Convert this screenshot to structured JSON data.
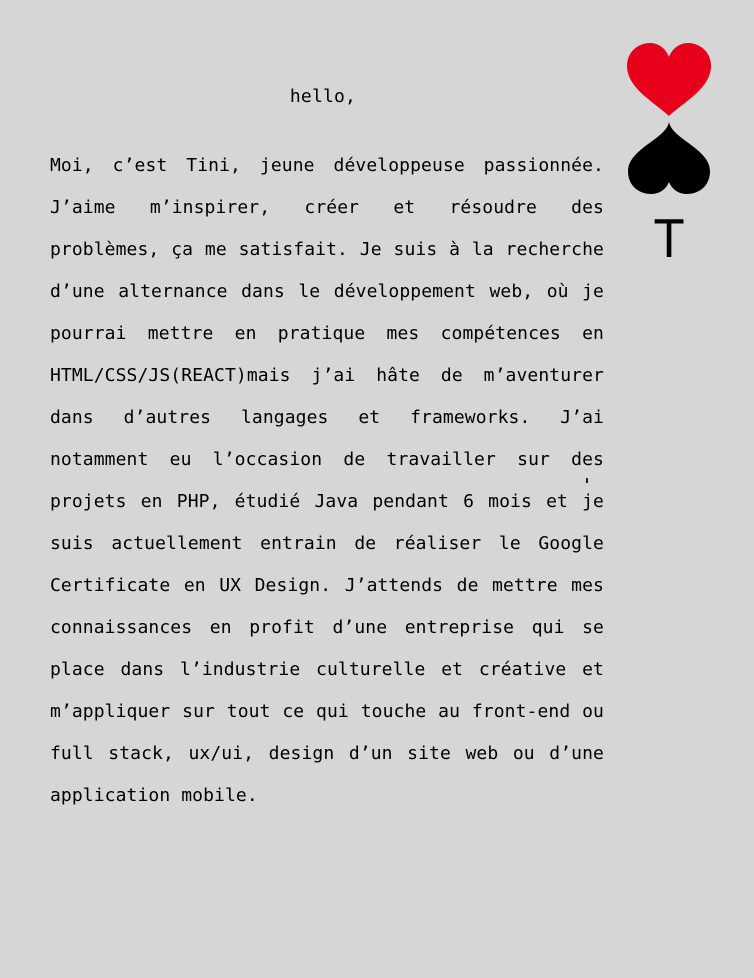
{
  "greeting": "hello,",
  "bio": "Moi, c’est Tini, jeune développeuse passionnée. J’aime m’inspirer, créer et résoudre des problèmes, ça me satisfait. Je suis à la recherche d’une alternance dans le développement web, où je pourrai mettre en pratique mes compétences en HTML/CSS/JS(REACT)mais j’ai hâte de m’aventurer dans d’autres langages et frameworks. J’ai notamment eu l’occasion de travailler sur des projets en PHP, étudié Java pendant 6 mois et je suis actuellement entrain de réaliser le Google Certificate en UX Design. J’attends de mettre mes connaissances en profit d’une entreprise qui se place dans l’industrie culturelle et créative et m’appliquer sur tout ce qui touche au front-end ou full stack, ux/ui, design d’un site web ou d’une application mobile.",
  "logo": {
    "letter": "T",
    "heart_icon": "heart-icon",
    "spade_icon": "spade-icon",
    "heart_color": "#e8001a",
    "spade_color": "#000000"
  },
  "colors": {
    "background": "#d6d6d6",
    "text": "#000000"
  }
}
